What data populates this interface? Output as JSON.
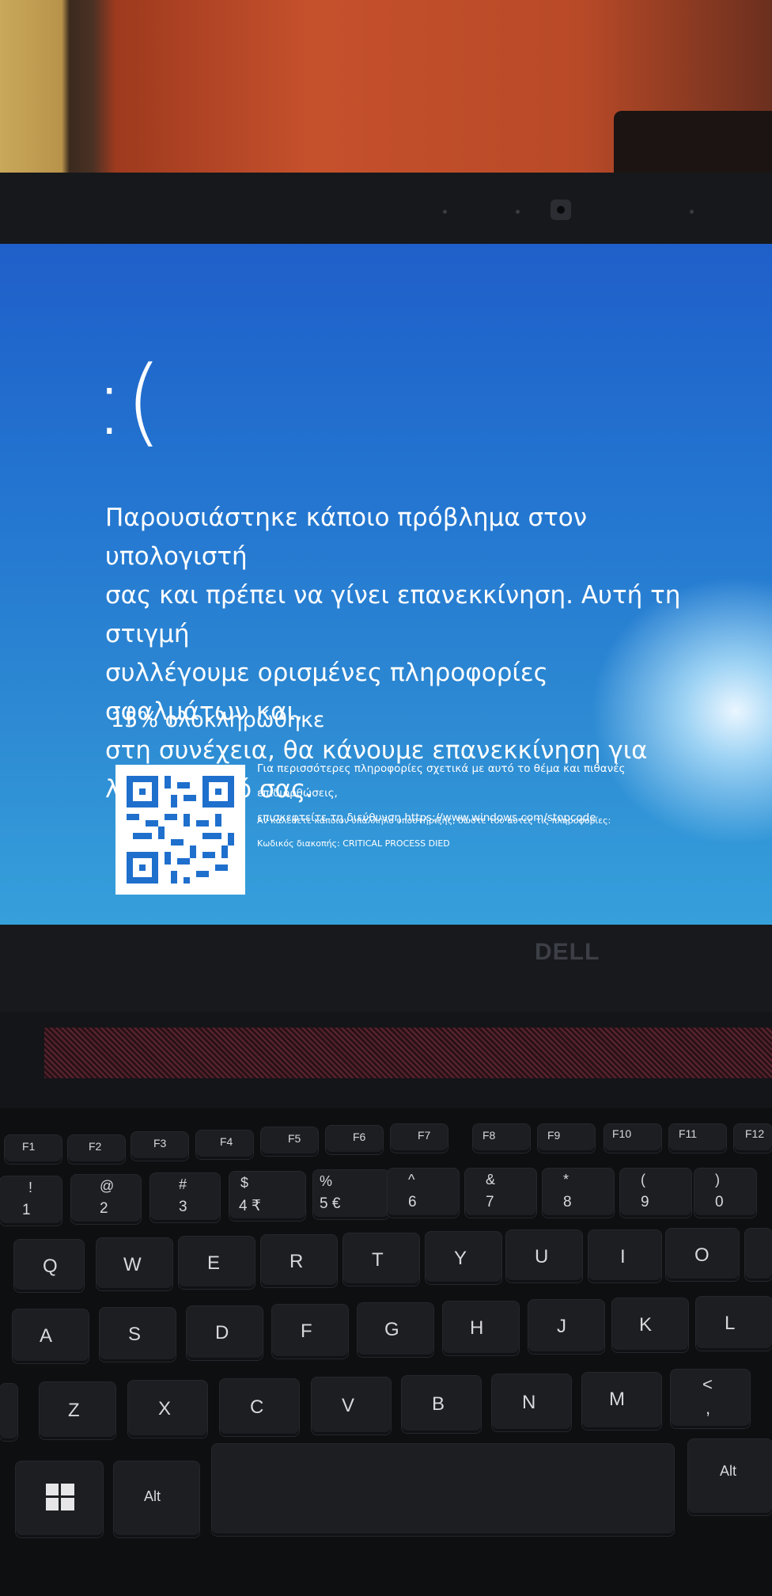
{
  "bsod": {
    "sad_face": ":(",
    "message_lines": [
      "Παρουσιάστηκε κάποιο πρόβλημα στον υπολογιστή",
      "σας και πρέπει να γίνει επανεκκίνηση. Αυτή τη στιγμή",
      "συλλέγουμε ορισμένες πληροφορίες σφαλμάτων και,",
      "στη συνέχεια, θα κάνουμε επανεκκίνηση για",
      "λογαριασμό σας."
    ],
    "progress_text": "15% ολοκληρώθηκε",
    "progress_percent": 15,
    "info_line1": "Για περισσότερες πληροφορίες σχετικά με αυτό το θέμα και πιθανές επιδιορθώσεις,",
    "info_line2": "επισκεφτείτε τη διεύθυνση https://www.windows.com/stopcode",
    "support_line": "Αν καλέσετε κάποιον υπάλληλο υποστήριξης, δώστε του αυτές τις πληροφορίες:",
    "stop_code_line": "Κωδικός διακοπής: CRITICAL PROCESS DIED"
  },
  "laptop": {
    "brand": "DELL"
  },
  "keyboard": {
    "fkeys": [
      "F1",
      "F2",
      "F3",
      "F4",
      "F5",
      "F6",
      "F7",
      "F8",
      "F9",
      "F10",
      "F11",
      "F12"
    ],
    "number_row": [
      {
        "top": "!",
        "bottom": "1"
      },
      {
        "top": "@",
        "bottom": "2"
      },
      {
        "top": "#",
        "bottom": "3"
      },
      {
        "top": "$",
        "bottom": "4 ₹"
      },
      {
        "top": "%",
        "bottom": "5 €"
      },
      {
        "top": "^",
        "bottom": "6"
      },
      {
        "top": "&",
        "bottom": "7"
      },
      {
        "top": "*",
        "bottom": "8"
      },
      {
        "top": "(",
        "bottom": "9"
      },
      {
        "top": ")",
        "bottom": "0"
      }
    ],
    "row_q": [
      "Q",
      "W",
      "E",
      "R",
      "T",
      "Y",
      "U",
      "I",
      "O"
    ],
    "row_a": [
      "A",
      "S",
      "D",
      "F",
      "G",
      "H",
      "J",
      "K",
      "L"
    ],
    "row_z": [
      "Z",
      "X",
      "C",
      "V",
      "B",
      "N",
      "M"
    ],
    "angle_key": {
      "top": "<",
      "bottom": ","
    },
    "alt_left": "Alt",
    "alt_right": "Alt",
    "win_icon": "windows-logo-icon"
  }
}
